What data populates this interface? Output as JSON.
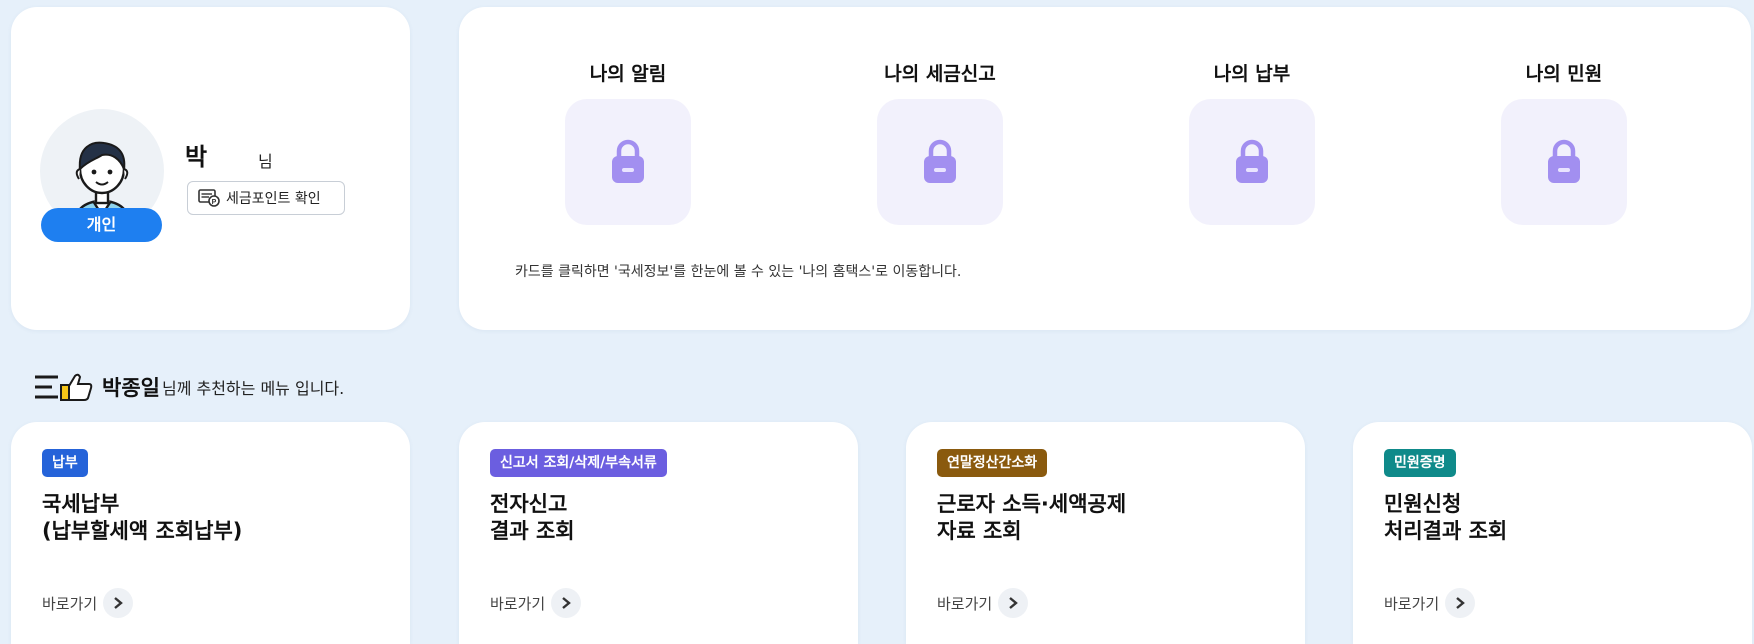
{
  "profile": {
    "badge": "개인",
    "name": "박",
    "suffix": "님",
    "point_button": "세금포인트 확인"
  },
  "status": {
    "items": [
      {
        "title": "나의 알림",
        "icon": "lock-icon"
      },
      {
        "title": "나의 세금신고",
        "icon": "lock-icon"
      },
      {
        "title": "나의 납부",
        "icon": "lock-icon"
      },
      {
        "title": "나의 민원",
        "icon": "lock-icon"
      }
    ],
    "note": "카드를 클릭하면 '국세정보'를 한눈에 볼 수 있는 '나의 홈택스'로 이동합니다."
  },
  "recommend": {
    "name": "박종일",
    "rest": "님께 추천하는 메뉴 입니다."
  },
  "menu_cards": [
    {
      "tag": "납부",
      "tag_color": "#2563d9",
      "title": "국세납부\n(납부할세액 조회납부)",
      "link": "바로가기"
    },
    {
      "tag": "신고서 조회/삭제/부속서류",
      "tag_color": "#6b5ee0",
      "title": "전자신고\n결과 조회",
      "link": "바로가기"
    },
    {
      "tag": "연말정산간소화",
      "tag_color": "#8a5a0e",
      "title": "근로자 소득·세액공제\n자료 조회",
      "link": "바로가기"
    },
    {
      "tag": "민원증명",
      "tag_color": "#0f8a8a",
      "title": "민원신청\n처리결과 조회",
      "link": "바로가기"
    }
  ],
  "colors": {
    "background": "#e6f0fa",
    "accent_blue": "#1e7ff0",
    "lock_bg": "#f2f1fc",
    "lock_fg": "#a28ff0"
  }
}
